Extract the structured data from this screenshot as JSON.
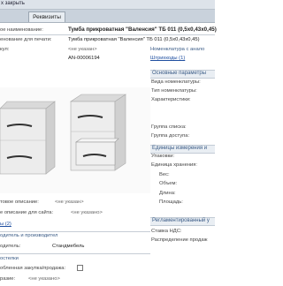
{
  "window": {
    "close_label": "х закрыть",
    "tab": "Реквизиты"
  },
  "fields": {
    "full_name_label": "ое наименование:",
    "full_name_value": "Тумба прикроватная \"Валенсия\" ТБ 011 (0,5х0,43х0,45)",
    "print_name_label": "енование для печати:",
    "print_name_value": "Тумба прикроватная \"Валенсия\" ТБ 011 (0,5х0,43х0,45)",
    "code_label": "кул:",
    "code_value": "<не указан>",
    "code_suffix": "Номенклатура с анало",
    "id_value": "АN-00006194",
    "barcodes": "Штрихкоды (1)"
  },
  "right_panel": {
    "main_params": "Основные параметры",
    "kind": "Вида номенклатуры:",
    "type": "Тип номенклатуры:",
    "characteristics": "Характеристики:",
    "group_list": "Группа списка:",
    "group_access": "Группа доступа:",
    "units_header": "Единицы измерения и",
    "packaging": "Упаковки:",
    "storage_unit": "Единица хранения:",
    "weight": "Вес:",
    "volume": "Объем:",
    "length": "Длина:",
    "area": "Площадь:",
    "accounting_header": "Регламентированный у",
    "vat_rate": "Ставка НДС:",
    "sales_distribution": "Распределение продаж"
  },
  "lower_left": {
    "rich_desc_label": "товое описание:",
    "rich_desc_value": "<не указан>",
    "site_desc_label": "е описание для сайта:",
    "site_desc_value": "<не указано>",
    "files": "ы (2)",
    "manufacturer_header": "одитель и производител",
    "manufacturer_label": "одитель:",
    "manufacturer_value": "Стандмебель",
    "checkbox_header": "остелки",
    "checkbox_label": "обленная закупка/продажа:",
    "last_label": "разие:",
    "last_value": "<не указано>"
  }
}
